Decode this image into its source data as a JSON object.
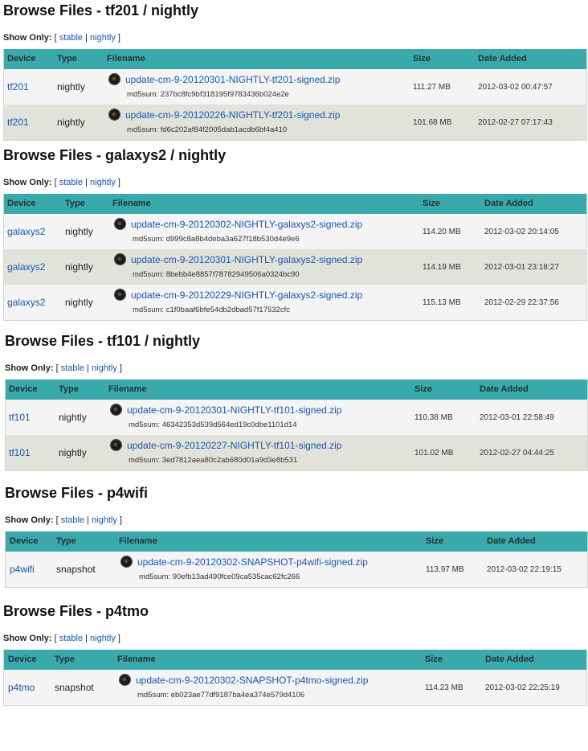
{
  "labels": {
    "show_only": "Show Only:",
    "open_bracket": "[",
    "close_bracket": "]",
    "separator": "|",
    "stable": "stable",
    "nightly": "nightly",
    "md5_prefix": "md5sum:",
    "col_device": "Device",
    "col_type": "Type",
    "col_filename": "Filename",
    "col_size": "Size",
    "col_date": "Date Added"
  },
  "sections": [
    {
      "title": "Browse Files - tf201 / nightly",
      "rows": [
        {
          "device": "tf201",
          "type": "nightly",
          "filename": "update-cm-9-20120301-NIGHTLY-tf201-signed.zip",
          "md5": "237bc8fc9bf318195f9783436b024e2e",
          "size": "111.27 MB",
          "date": "2012-03-02 00:47:57"
        },
        {
          "device": "tf201",
          "type": "nightly",
          "filename": "update-cm-9-20120226-NIGHTLY-tf201-signed.zip",
          "md5": "fd6c202af84f2005dab1acdb6bf4a410",
          "size": "101.68 MB",
          "date": "2012-02-27 07:17:43"
        }
      ]
    },
    {
      "title": "Browse Files - galaxys2 / nightly",
      "rows": [
        {
          "device": "galaxys2",
          "type": "nightly",
          "filename": "update-cm-9-20120302-NIGHTLY-galaxys2-signed.zip",
          "md5": "d999c8a8b4deba3a627f18b530d4e9e6",
          "size": "114.20 MB",
          "date": "2012-03-02 20:14:05"
        },
        {
          "device": "galaxys2",
          "type": "nightly",
          "filename": "update-cm-9-20120301-NIGHTLY-galaxys2-signed.zip",
          "md5": "8bebb4e8857f78782949506a0324bc90",
          "size": "114.19 MB",
          "date": "2012-03-01 23:18:27"
        },
        {
          "device": "galaxys2",
          "type": "nightly",
          "filename": "update-cm-9-20120229-NIGHTLY-galaxys2-signed.zip",
          "md5": "c1f0baaf6bfe54db2dbad57f17532cfc",
          "size": "115.13 MB",
          "date": "2012-02-29 22:37:56"
        }
      ]
    },
    {
      "title": "Browse Files - tf101 / nightly",
      "rows": [
        {
          "device": "tf101",
          "type": "nightly",
          "filename": "update-cm-9-20120301-NIGHTLY-tf101-signed.zip",
          "md5": "46342353d539d564ed19c0dbe1101d14",
          "size": "110.38 MB",
          "date": "2012-03-01 22:58:49"
        },
        {
          "device": "tf101",
          "type": "nightly",
          "filename": "update-cm-9-20120227-NIGHTLY-tf101-signed.zip",
          "md5": "3ed7812aea80c2ab680d01a9d3e8b531",
          "size": "101.02 MB",
          "date": "2012-02-27 04:44:25"
        }
      ]
    },
    {
      "title": "Browse Files - p4wifi",
      "rows": [
        {
          "device": "p4wifi",
          "type": "snapshot",
          "filename": "update-cm-9-20120302-SNAPSHOT-p4wifi-signed.zip",
          "md5": "90efb13ad490fce09ca535cac62fc266",
          "size": "113.97 MB",
          "date": "2012-03-02 22:19:15"
        }
      ]
    },
    {
      "title": "Browse Files - p4tmo",
      "rows": [
        {
          "device": "p4tmo",
          "type": "snapshot",
          "filename": "update-cm-9-20120302-SNAPSHOT-p4tmo-signed.zip",
          "md5": "eb023ae77df9187ba4ea374e579d4106",
          "size": "114.23 MB",
          "date": "2012-03-02 22:25:19"
        }
      ]
    }
  ]
}
